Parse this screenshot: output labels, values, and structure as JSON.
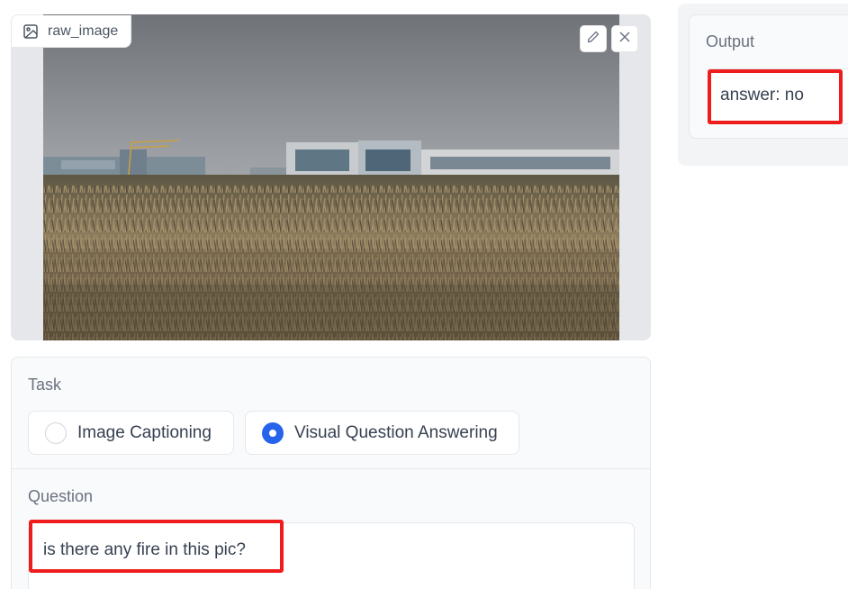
{
  "image_panel": {
    "label": "raw_image",
    "label_icon": "image-icon",
    "edit_icon": "pencil-icon",
    "close_icon": "close-icon"
  },
  "task": {
    "label": "Task",
    "options": [
      {
        "label": "Image Captioning",
        "selected": false
      },
      {
        "label": "Visual Question Answering",
        "selected": true
      }
    ]
  },
  "question": {
    "label": "Question",
    "value": "is there any fire in this pic?"
  },
  "output": {
    "label": "Output",
    "value": "answer: no"
  },
  "colors": {
    "accent": "#2563eb",
    "highlight": "#ee1c1c",
    "border": "#e5e7eb"
  }
}
